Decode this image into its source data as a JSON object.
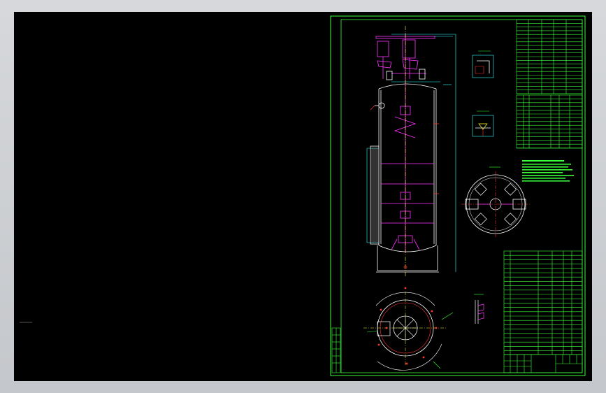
{
  "app": {
    "title": ""
  },
  "colors": {
    "frame": "#3aff3a",
    "vessel": "#ffffff",
    "agitator": "#ff33ff",
    "dims": "#ff3333",
    "centerline": "#ffff33",
    "leaders": "#33ffff"
  },
  "drawing": {
    "title_block": {
      "name": "",
      "scale": ""
    },
    "tables": {
      "design_data": [],
      "nozzles": [],
      "parts_list": []
    },
    "views": [
      "front-elevation",
      "plan-view",
      "lug-section-view",
      "weld-detail-1",
      "weld-detail-2",
      "flange-detail"
    ],
    "icons": [
      "cad-drawing-sheet-icon"
    ]
  }
}
